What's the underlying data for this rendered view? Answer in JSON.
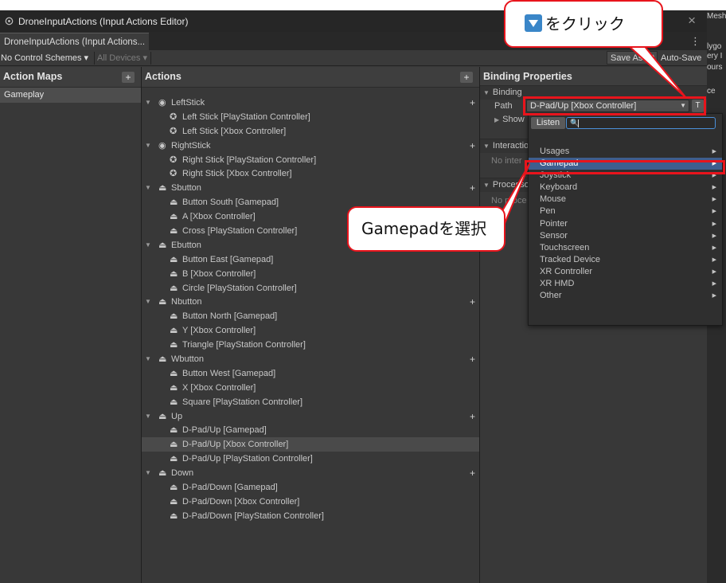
{
  "window": {
    "title": "DroneInputActions (Input Actions Editor)",
    "tab_label": "DroneInputActions (Input Actions...",
    "more": "⋮",
    "close": "×"
  },
  "toolbar": {
    "control_schemes": "No Control Schemes ▾",
    "devices": "All Devices ▾",
    "save_label": "Save Asset",
    "autosave_label": "Auto-Save"
  },
  "right_edge": [
    "Mesh",
    "lygo",
    "ery I",
    "ours",
    "ce"
  ],
  "maps": {
    "header": "Action Maps",
    "add": "+",
    "items": [
      "Gameplay"
    ]
  },
  "actions": {
    "header": "Actions",
    "add": "+",
    "rows": [
      {
        "kind": "action",
        "icon": "◉",
        "label": "LeftStick"
      },
      {
        "kind": "binding",
        "icon": "✪",
        "label": "Left Stick [PlayStation Controller]"
      },
      {
        "kind": "binding",
        "icon": "✪",
        "label": "Left Stick [Xbox Controller]"
      },
      {
        "kind": "action",
        "icon": "◉",
        "label": "RightStick"
      },
      {
        "kind": "binding",
        "icon": "✪",
        "label": "Right Stick [PlayStation Controller]"
      },
      {
        "kind": "binding",
        "icon": "✪",
        "label": "Right Stick [Xbox Controller]"
      },
      {
        "kind": "action",
        "icon": "⏏",
        "label": "Sbutton"
      },
      {
        "kind": "binding",
        "icon": "⏏",
        "label": "Button South [Gamepad]"
      },
      {
        "kind": "binding",
        "icon": "⏏",
        "label": "A [Xbox Controller]"
      },
      {
        "kind": "binding",
        "icon": "⏏",
        "label": "Cross [PlayStation Controller]"
      },
      {
        "kind": "action",
        "icon": "⏏",
        "label": "Ebutton"
      },
      {
        "kind": "binding",
        "icon": "⏏",
        "label": "Button East [Gamepad]"
      },
      {
        "kind": "binding",
        "icon": "⏏",
        "label": "B [Xbox Controller]"
      },
      {
        "kind": "binding",
        "icon": "⏏",
        "label": "Circle [PlayStation Controller]"
      },
      {
        "kind": "action",
        "icon": "⏏",
        "label": "Nbutton"
      },
      {
        "kind": "binding",
        "icon": "⏏",
        "label": "Button North [Gamepad]"
      },
      {
        "kind": "binding",
        "icon": "⏏",
        "label": "Y [Xbox Controller]"
      },
      {
        "kind": "binding",
        "icon": "⏏",
        "label": "Triangle [PlayStation Controller]"
      },
      {
        "kind": "action",
        "icon": "⏏",
        "label": "Wbutton"
      },
      {
        "kind": "binding",
        "icon": "⏏",
        "label": "Button West [Gamepad]"
      },
      {
        "kind": "binding",
        "icon": "⏏",
        "label": "X [Xbox Controller]"
      },
      {
        "kind": "binding",
        "icon": "⏏",
        "label": "Square [PlayStation Controller]"
      },
      {
        "kind": "action",
        "icon": "⏏",
        "label": "Up"
      },
      {
        "kind": "binding",
        "icon": "⏏",
        "label": "D-Pad/Up [Gamepad]"
      },
      {
        "kind": "binding",
        "icon": "⏏",
        "label": "D-Pad/Up [Xbox Controller]",
        "selected": true
      },
      {
        "kind": "binding",
        "icon": "⏏",
        "label": "D-Pad/Up [PlayStation Controller]"
      },
      {
        "kind": "action",
        "icon": "⏏",
        "label": "Down"
      },
      {
        "kind": "binding",
        "icon": "⏏",
        "label": "D-Pad/Down [Gamepad]"
      },
      {
        "kind": "binding",
        "icon": "⏏",
        "label": "D-Pad/Down [Xbox Controller]"
      },
      {
        "kind": "binding",
        "icon": "⏏",
        "label": "D-Pad/Down [PlayStation Controller]"
      }
    ]
  },
  "properties": {
    "header": "Binding Properties",
    "binding_section": "Binding",
    "path_label": "Path",
    "path_value": "D-Pad/Up [Xbox Controller]",
    "t_button": "T",
    "show_label": "Show",
    "interactions_section": "Interactio",
    "no_interactions": "No inter",
    "processors_section": "Processo",
    "no_processors": "No proce"
  },
  "popup": {
    "listen_label": "Listen",
    "search_value": "",
    "items": [
      {
        "label": "Usages"
      },
      {
        "label": "Gamepad",
        "highlight": true
      },
      {
        "label": "Joystick"
      },
      {
        "label": "Keyboard"
      },
      {
        "label": "Mouse"
      },
      {
        "label": "Pen"
      },
      {
        "label": "Pointer"
      },
      {
        "label": "Sensor"
      },
      {
        "label": "Touchscreen"
      },
      {
        "label": "Tracked Device"
      },
      {
        "label": "XR Controller"
      },
      {
        "label": "XR HMD"
      },
      {
        "label": "Other"
      }
    ]
  },
  "annotations": {
    "click_text": "をクリック",
    "select_text": "Gamepadを選択",
    "accent": "#e8141c"
  }
}
